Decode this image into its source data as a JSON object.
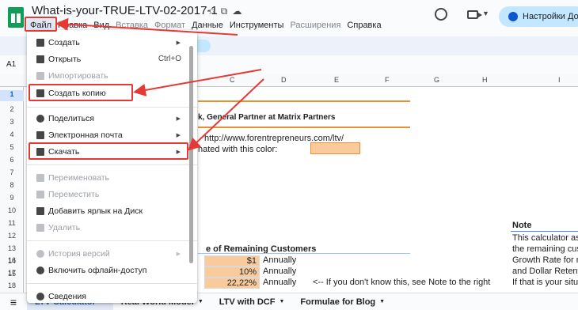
{
  "header": {
    "doc_title": "What-is-your-TRUE-LTV-02-2017-1",
    "share_label": "Настройки Дос",
    "menus": [
      {
        "label": "Файл",
        "enabled": true,
        "active": true
      },
      {
        "label": "Правка",
        "enabled": true
      },
      {
        "label": "Вид",
        "enabled": true
      },
      {
        "label": "Вставка",
        "enabled": false
      },
      {
        "label": "Формат",
        "enabled": false
      },
      {
        "label": "Данные",
        "enabled": true
      },
      {
        "label": "Инструменты",
        "enabled": true
      },
      {
        "label": "Расширения",
        "enabled": false
      },
      {
        "label": "Справка",
        "enabled": true
      }
    ]
  },
  "namebox": "A1",
  "columns": [
    "C",
    "D",
    "E",
    "F",
    "G",
    "H",
    "I"
  ],
  "rows": [
    "1",
    "2",
    "3",
    "4",
    "5",
    "6",
    "7",
    "8",
    "9",
    "10",
    "11",
    "12",
    "13",
    "14",
    "15",
    "16",
    "17",
    "18"
  ],
  "sheet": {
    "partner_text": "k, General Partner at Matrix Partners",
    "url_text": "http://www.forentrepreneurs.com/ltv/",
    "color_text": "nated with this color:",
    "section_title": "e of Remaining Customers",
    "values": [
      {
        "value": "$1",
        "unit": "Annually"
      },
      {
        "value": "10%",
        "unit": "Annually"
      },
      {
        "value": "22,22%",
        "unit": "Annually"
      }
    ],
    "hint": "<-- If you don't know this, see Note to the right",
    "note_title": "Note",
    "note_lines": [
      "This calculator assu",
      "the remaining custo",
      "Growth Rate for re",
      "and Dollar Retentio",
      "If that is your situat"
    ]
  },
  "file_menu": {
    "items": [
      {
        "label": "Создать",
        "icon": "plus-square-icon",
        "enabled": true,
        "submenu": true
      },
      {
        "label": "Открыть",
        "icon": "folder-icon",
        "enabled": true,
        "shortcut": "Ctrl+O"
      },
      {
        "label": "Импортировать",
        "icon": "import-icon",
        "enabled": false
      },
      {
        "label": "Создать копию",
        "icon": "copy-icon",
        "enabled": true
      },
      {
        "label": "Поделиться",
        "icon": "share-person-icon",
        "enabled": true,
        "submenu": true
      },
      {
        "label": "Электронная почта",
        "icon": "mail-icon",
        "enabled": true,
        "submenu": true
      },
      {
        "label": "Скачать",
        "icon": "download-icon",
        "enabled": true,
        "submenu": true
      },
      {
        "label": "Переименовать",
        "icon": "rename-icon",
        "enabled": false
      },
      {
        "label": "Переместить",
        "icon": "move-icon",
        "enabled": false
      },
      {
        "label": "Добавить ярлык на Диск",
        "icon": "drive-shortcut-icon",
        "enabled": true
      },
      {
        "label": "Удалить",
        "icon": "trash-icon",
        "enabled": false
      },
      {
        "label": "История версий",
        "icon": "history-icon",
        "enabled": false,
        "submenu": true
      },
      {
        "label": "Включить офлайн-доступ",
        "icon": "offline-icon",
        "enabled": true
      },
      {
        "label": "Сведения",
        "icon": "info-icon",
        "enabled": true
      }
    ]
  },
  "tabs": [
    {
      "label": "LTV Calculator",
      "active": true
    },
    {
      "label": "Real World Model"
    },
    {
      "label": "LTV with DCF"
    },
    {
      "label": "Formulae for Blog"
    }
  ],
  "colors": {
    "annotation_red": "#e53935",
    "accent_orange": "#e69138",
    "cell_orange": "#f9cb9c",
    "share_blue": "#c2e7ff"
  }
}
